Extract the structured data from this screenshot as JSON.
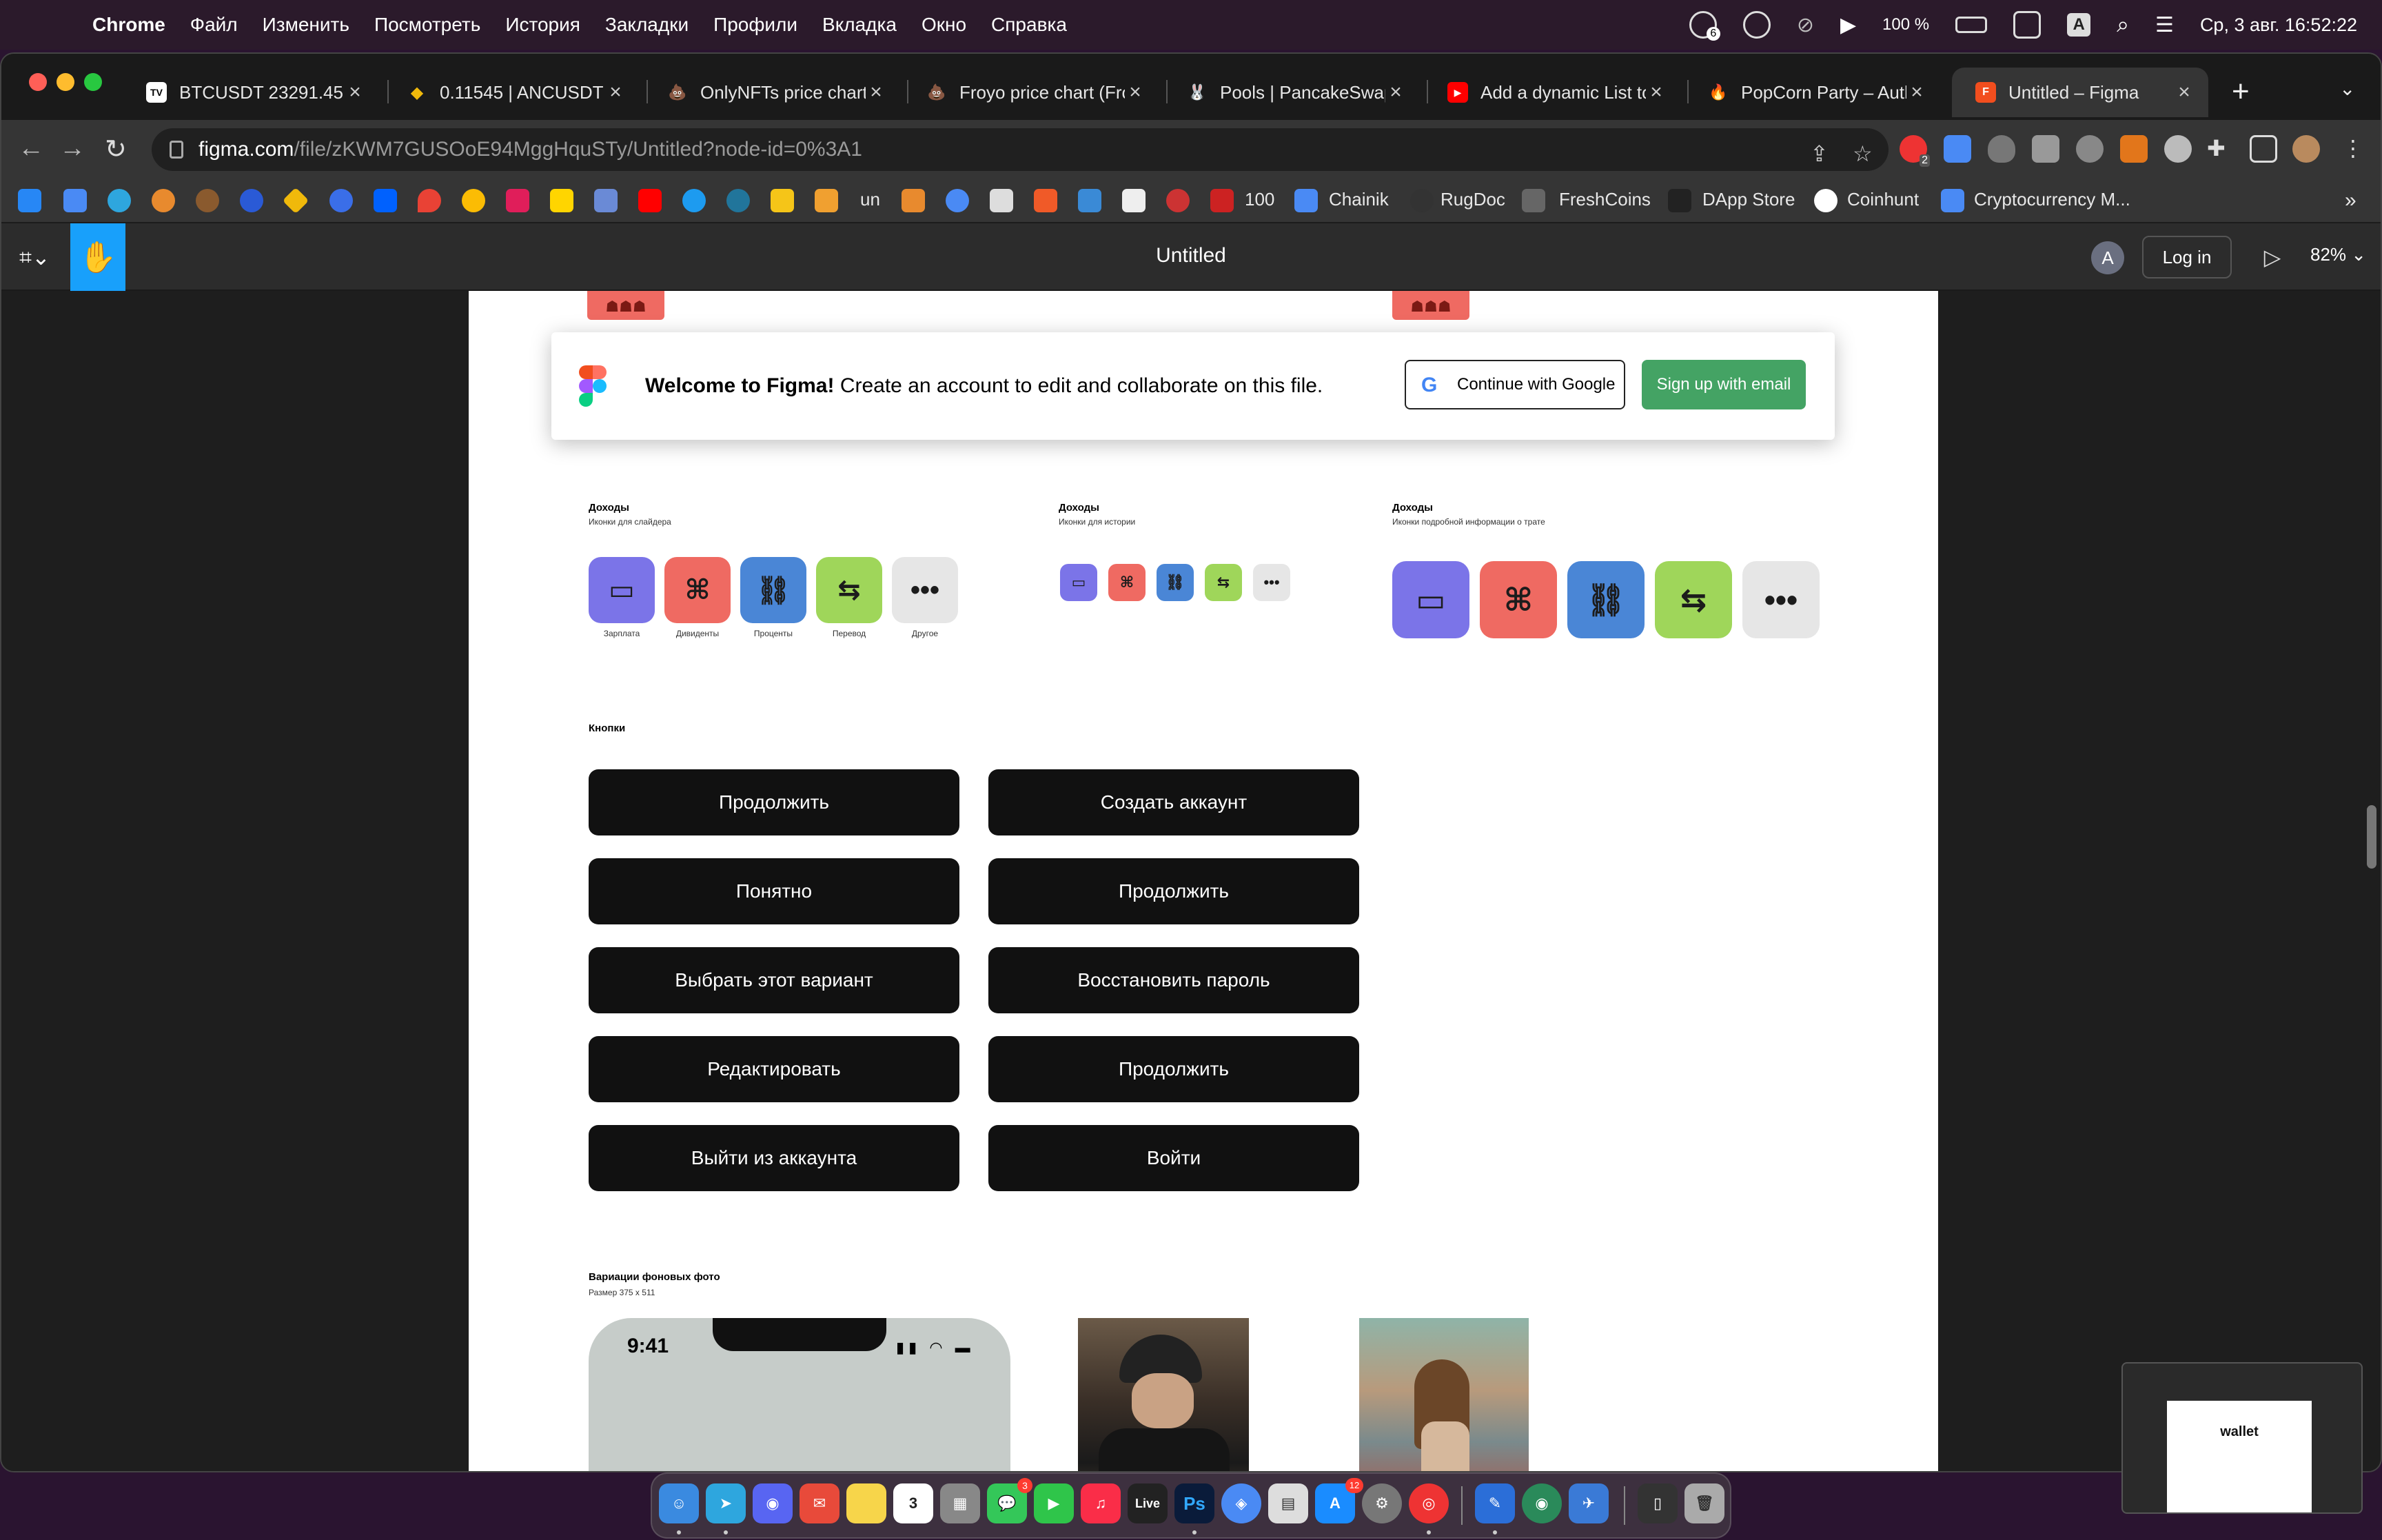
{
  "menubar": {
    "app_name": "Chrome",
    "items": [
      "Файл",
      "Изменить",
      "Посмотреть",
      "История",
      "Закладки",
      "Профили",
      "Вкладка",
      "Окно",
      "Справка"
    ],
    "battery": "100 %",
    "datetime": "Ср, 3 авг.  16:52:22",
    "keyboard_badge": "A",
    "notification_badge": "6"
  },
  "tabs": [
    {
      "title": "BTCUSDT 23291.45 ▲",
      "favicon": "TV"
    },
    {
      "title": "0.11545  |  ANCUSDT",
      "favicon": "◆"
    },
    {
      "title": "OnlyNFTs price chart",
      "favicon": "💩"
    },
    {
      "title": "Froyo price chart (Fro",
      "favicon": "💩"
    },
    {
      "title": "Pools | PancakeSwap",
      "favicon": "🐰"
    },
    {
      "title": "Add a dynamic List to",
      "favicon": "▶"
    },
    {
      "title": "PopCorn Party – Auth",
      "favicon": "🔥"
    },
    {
      "title": "Untitled – Figma",
      "favicon": "F",
      "active": true
    }
  ],
  "omnibox": {
    "host": "figma.com",
    "path": "/file/zKWM7GUSOoE94MggHquSTy/Untitled?node-id=0%3A1",
    "ext_badge": "2"
  },
  "bookmarks": [
    {
      "label": "100"
    },
    {
      "label": "Chainik"
    },
    {
      "label": "RugDoc"
    },
    {
      "label": "FreshCoins"
    },
    {
      "label": "DApp Store"
    },
    {
      "label": "Coinhunt"
    },
    {
      "label": "Cryptocurrency M..."
    }
  ],
  "bookmarks_more": "»",
  "figma": {
    "file_title": "Untitled",
    "avatar_initial": "A",
    "login_label": "Log in",
    "zoom": "82% ⌄"
  },
  "welcome": {
    "bold": "Welcome to Figma!",
    "text": " Create an account to edit and collaborate on this file.",
    "google_label": "Continue with Google",
    "email_label": "Sign up with email"
  },
  "income_sections": [
    {
      "title": "Доходы",
      "subtitle": "Иконки для слайдера"
    },
    {
      "title": "Доходы",
      "subtitle": "Иконки для истории"
    },
    {
      "title": "Доходы",
      "subtitle": "Иконки подробной информации о трате"
    }
  ],
  "income_icons": [
    {
      "name": "salary-icon",
      "caption": "Зарплата",
      "color": "#7b74e8",
      "glyph": "▭"
    },
    {
      "name": "dividends-icon",
      "caption": "Дивиденты",
      "color": "#ef6a62",
      "glyph": "⌘"
    },
    {
      "name": "link-icon",
      "caption": "Проценты",
      "color": "#4a86d6",
      "glyph": "⛓"
    },
    {
      "name": "transfer-icon",
      "caption": "Перевод",
      "color": "#9fd65a",
      "glyph": "⇆"
    },
    {
      "name": "more-icon",
      "caption": "Другое",
      "color": "#e6e6e6",
      "glyph": "•••"
    }
  ],
  "buttons_section": {
    "title": "Кнопки"
  },
  "buttons_left": [
    "Продолжить",
    "Понятно",
    "Выбрать этот вариант",
    "Редактировать",
    "Выйти из аккаунта"
  ],
  "buttons_right": [
    "Создать аккаунт",
    "Продолжить",
    "Восстановить пароль",
    "Продолжить",
    "Войти"
  ],
  "photos_section": {
    "title": "Вариации фоновых фото",
    "subtitle": "Размер 375 x 511"
  },
  "phone": {
    "time": "9:41"
  },
  "minimap": {
    "title": "wallet"
  },
  "dock_badges": {
    "messages": "3",
    "appstore": "12",
    "calendar_day": "3"
  }
}
